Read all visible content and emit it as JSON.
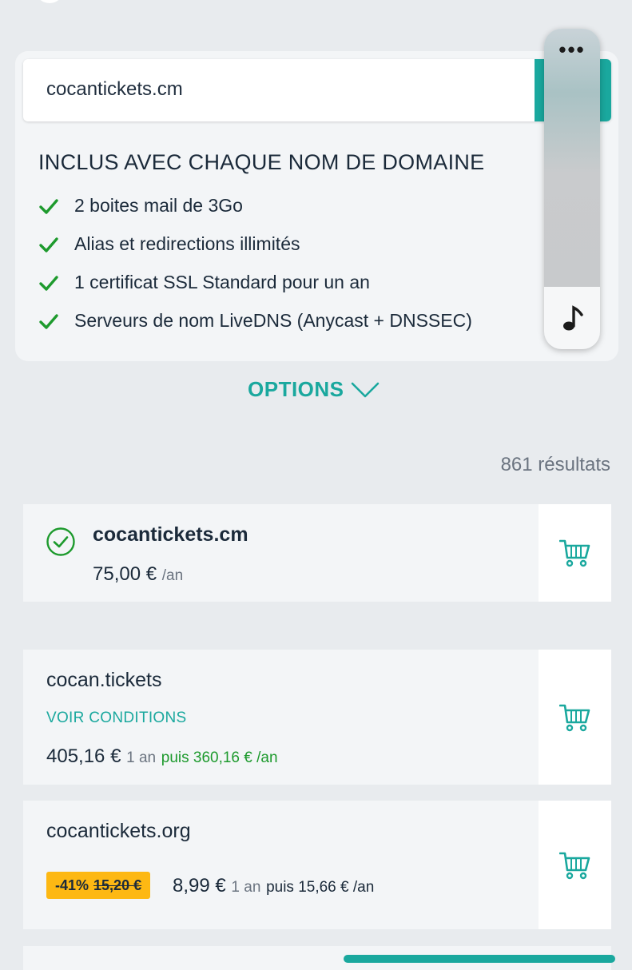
{
  "search": {
    "value": "cocantickets.cm"
  },
  "included": {
    "title": "INCLUS AVEC CHAQUE NOM DE DOMAINE",
    "features": [
      "2 boites mail de 3Go",
      "Alias et redirections illimités",
      "1 certificat SSL Standard pour un an",
      "Serveurs de nom LiveDNS (Anycast + DNSSEC)"
    ]
  },
  "side_widget": {
    "menu_glyph": "•••",
    "icon": "music-note-icon"
  },
  "options": {
    "label": "OPTIONS",
    "icon": "chevron-down-icon"
  },
  "results": {
    "count_text": "861 résultats"
  },
  "cards": [
    {
      "domain": "cocantickets.cm",
      "status_icon": "check-circle-icon",
      "price": "75,00 €",
      "unit": "/an"
    },
    {
      "domain": "cocan.tickets",
      "conditions": "VOIR CONDITIONS",
      "price": "405,16 €",
      "period": "1 an",
      "renewal": "puis 360,16 € /an"
    },
    {
      "domain": "cocantickets.org",
      "discount_pct": "-41%",
      "old_price": "15,20 €",
      "price": "8,99 €",
      "period": "1 an",
      "renewal": "puis 15,66 € /an"
    }
  ],
  "colors": {
    "accent": "#1aa89e",
    "check": "#1d9a2d",
    "badge": "#fdb813"
  }
}
